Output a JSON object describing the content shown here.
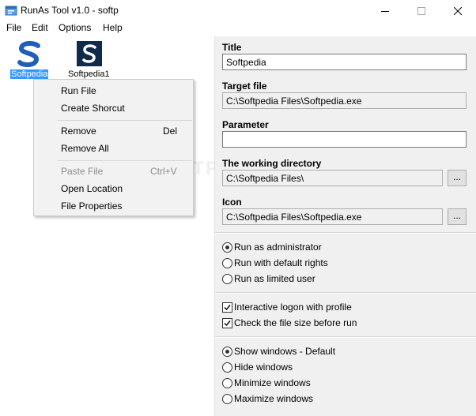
{
  "window": {
    "title": "RunAs Tool v1.0 - softp"
  },
  "menu": [
    "File",
    "Edit",
    "Options",
    "Help"
  ],
  "files": [
    {
      "label": "Softpedia",
      "selected": true,
      "icon": "softpedia-s-icon"
    },
    {
      "label": "Softpedia1",
      "selected": false,
      "icon": "softpedia-s-dark-icon"
    }
  ],
  "context_menu": {
    "items": [
      {
        "label": "Run File",
        "shortcut": "",
        "enabled": true
      },
      {
        "label": "Create Shorcut",
        "shortcut": "",
        "enabled": true
      },
      {
        "label": "Remove",
        "shortcut": "Del",
        "enabled": true
      },
      {
        "label": "Remove All",
        "shortcut": "",
        "enabled": true
      },
      {
        "label": "Paste File",
        "shortcut": "Ctrl+V",
        "enabled": false
      },
      {
        "label": "Open Location",
        "shortcut": "",
        "enabled": true
      },
      {
        "label": "File Properties",
        "shortcut": "",
        "enabled": true
      }
    ]
  },
  "form": {
    "title_label": "Title",
    "title_value": "Softpedia",
    "target_label": "Target file",
    "target_value": "C:\\Softpedia Files\\Softpedia.exe",
    "parameter_label": "Parameter",
    "parameter_value": "",
    "workdir_label": "The working directory",
    "workdir_value": "C:\\Softpedia Files\\",
    "icon_label": "Icon",
    "icon_value": "C:\\Softpedia Files\\Softpedia.exe",
    "browse_label": "..."
  },
  "run_options": [
    {
      "label": "Run as administrator",
      "checked": true
    },
    {
      "label": "Run with default rights",
      "checked": false
    },
    {
      "label": "Run as limited user",
      "checked": false
    }
  ],
  "checkboxes": [
    {
      "label": "Interactive logon with profile",
      "checked": true
    },
    {
      "label": "Check the file size before run",
      "checked": true
    }
  ],
  "window_options": [
    {
      "label": "Show windows - Default",
      "checked": true
    },
    {
      "label": "Hide windows",
      "checked": false
    },
    {
      "label": "Minimize windows",
      "checked": false
    },
    {
      "label": "Maximize windows",
      "checked": false
    }
  ],
  "watermark": "SOFTPEDIA",
  "colors": {
    "selection": "#3399ff",
    "softpedia_blue": "#1f5fb8",
    "softpedia_dark": "#0f2a4a"
  }
}
